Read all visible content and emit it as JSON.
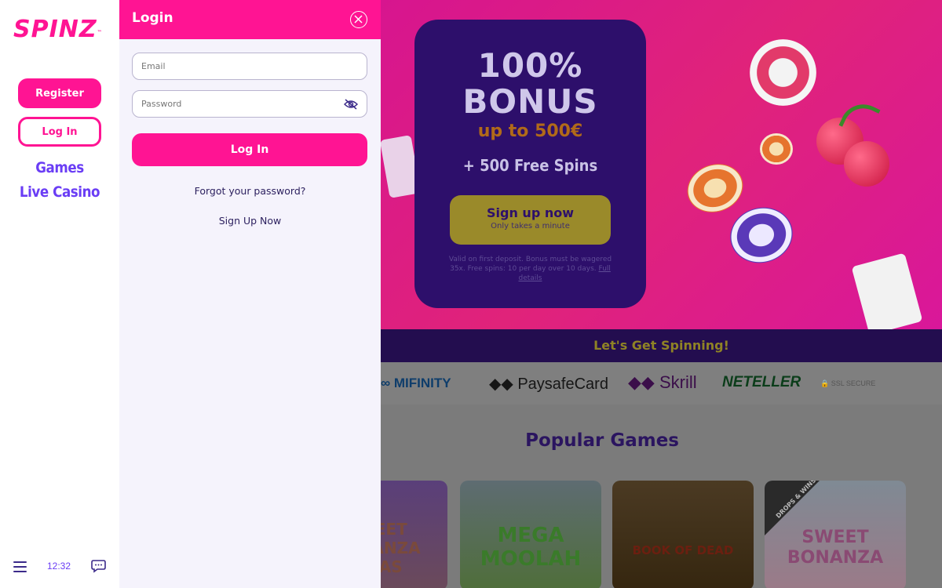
{
  "sidebar": {
    "logo": "SPINZ",
    "logo_tm": "™",
    "register_label": "Register",
    "login_label": "Log In",
    "nav": [
      {
        "label": "Games"
      },
      {
        "label": "Live Casino"
      }
    ],
    "clock": "12:32"
  },
  "login": {
    "title": "Login",
    "email_placeholder": "Email",
    "password_placeholder": "Password",
    "submit_label": "Log In",
    "forgot_label": "Forgot your password?",
    "signup_label": "Sign Up Now"
  },
  "promo": {
    "pct": "100%",
    "bonus": "BONUS",
    "upto": "up to 500€",
    "free_spins": "+ 500 Free Spins",
    "cta_main": "Sign up now",
    "cta_sub": "Only takes a minute",
    "terms": "Valid on first deposit. Bonus must be wagered 35x. Free spins: 10 per day over 10 days.",
    "terms_link": "Full details"
  },
  "strip_text": "Let's Get Spinning!",
  "payments": [
    "MIFINITY",
    "PaysafeCard",
    "Skrill",
    "NETELLER",
    "SSL SECURE"
  ],
  "popular": {
    "title": "Popular Games",
    "games": [
      {
        "title": "SWEET BONANZA XMAS"
      },
      {
        "title": "MEGA MOOLAH"
      },
      {
        "title": "BOOK OF DEAD"
      },
      {
        "title": "SWEET BONANZA"
      }
    ],
    "badge": "DROPS & WINS"
  },
  "colors": {
    "brand_pink": "#ff1493",
    "brand_purple": "#6a3df5",
    "panel_bg": "#f5f3fc"
  }
}
